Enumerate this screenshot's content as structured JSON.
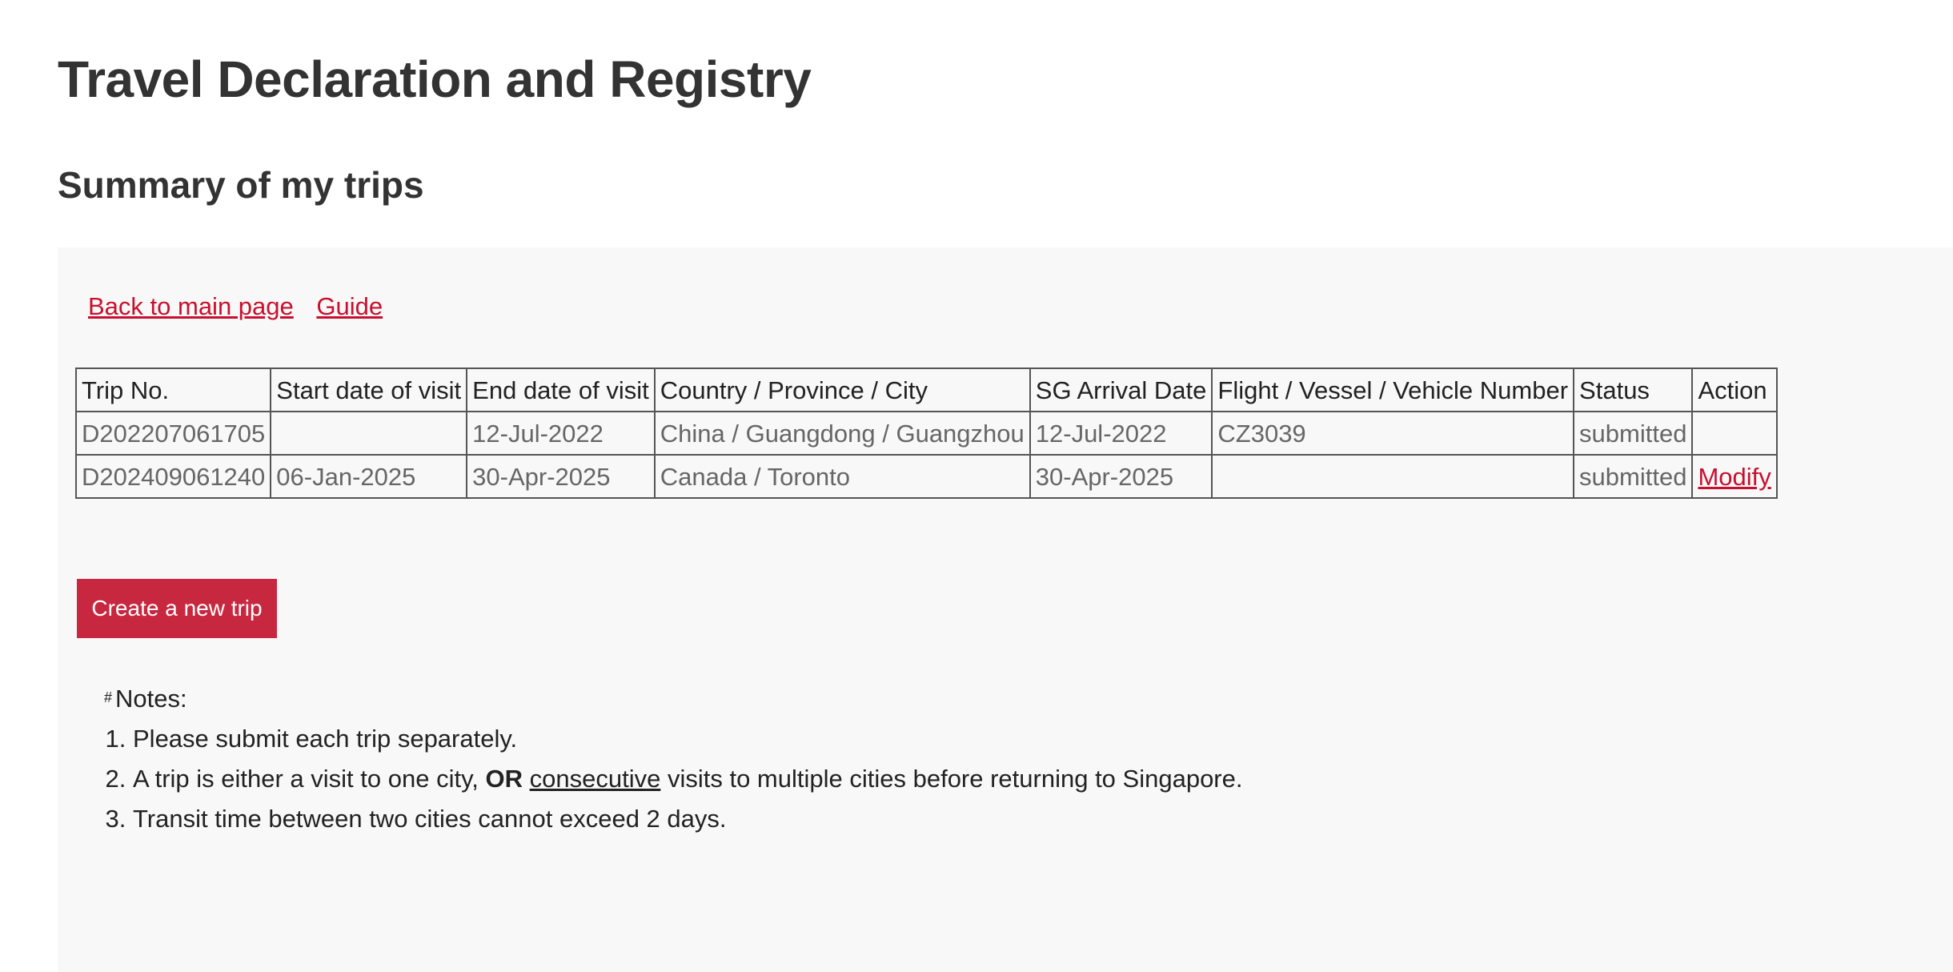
{
  "page_title": "Travel Declaration and Registry",
  "section_title": "Summary of my trips",
  "links": {
    "back": "Back to main page",
    "guide": "Guide"
  },
  "table": {
    "headers": [
      "Trip No.",
      "Start date of visit",
      "End date of visit",
      "Country / Province / City",
      "SG Arrival Date",
      "Flight / Vessel / Vehicle Number",
      "Status",
      "Action"
    ],
    "rows": [
      {
        "trip_no": "D202207061705",
        "start_date": "",
        "end_date": "12-Jul-2022",
        "location": "China / Guangdong / Guangzhou",
        "sg_arrival": "12-Jul-2022",
        "flight": "CZ3039",
        "status": "submitted",
        "action": ""
      },
      {
        "trip_no": "D202409061240",
        "start_date": "06-Jan-2025",
        "end_date": "30-Apr-2025",
        "location": "Canada / Toronto",
        "sg_arrival": "30-Apr-2025",
        "flight": "",
        "status": "submitted",
        "action": "Modify"
      }
    ]
  },
  "create_button": "Create a new trip",
  "notes": {
    "marker": "#",
    "heading": "Notes:",
    "item1": "Please submit each trip separately.",
    "item2_part1": "A trip is either a visit to one city, ",
    "item2_bold": "OR",
    "item2_part2": " ",
    "item2_underline": "consecutive",
    "item2_part3": " visits to multiple cities before returning to Singapore.",
    "item3": "Transit time between two cities cannot exceed 2 days."
  },
  "colors": {
    "accent": "#c8102e",
    "button": "#c8283f",
    "panel_bg": "#f8f8f8",
    "text": "#333333"
  }
}
